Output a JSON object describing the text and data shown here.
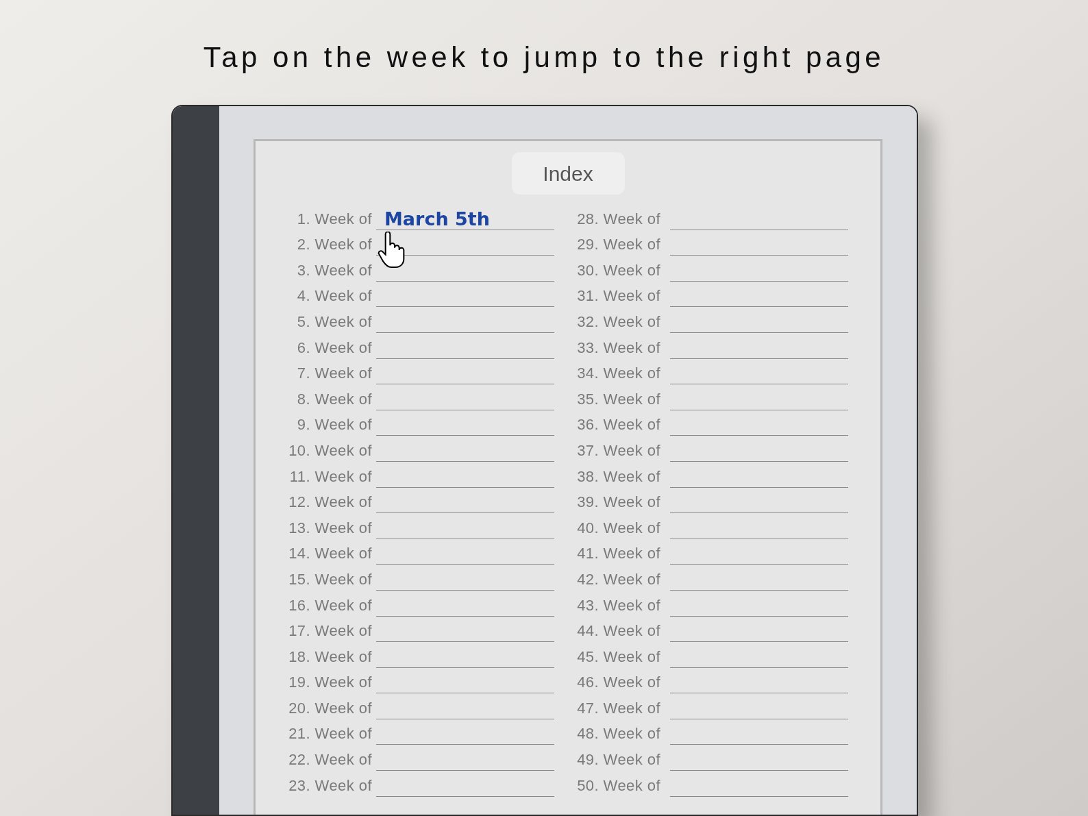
{
  "headline": "Tap on the week to jump to the right page",
  "index": {
    "title": "Index",
    "columns": [
      {
        "entries": [
          {
            "number": "1.",
            "label": "Week of",
            "value": "March 5th"
          },
          {
            "number": "2.",
            "label": "Week of"
          },
          {
            "number": "3.",
            "label": "Week of"
          },
          {
            "number": "4.",
            "label": "Week of"
          },
          {
            "number": "5.",
            "label": "Week of"
          },
          {
            "number": "6.",
            "label": "Week of"
          },
          {
            "number": "7.",
            "label": "Week of"
          },
          {
            "number": "8.",
            "label": "Week of"
          },
          {
            "number": "9.",
            "label": "Week of"
          },
          {
            "number": "10.",
            "label": "Week of"
          },
          {
            "number": "11.",
            "label": "Week of"
          },
          {
            "number": "12.",
            "label": "Week of"
          },
          {
            "number": "13.",
            "label": "Week of"
          },
          {
            "number": "14.",
            "label": "Week of"
          },
          {
            "number": "15.",
            "label": "Week of"
          },
          {
            "number": "16.",
            "label": "Week of"
          },
          {
            "number": "17.",
            "label": "Week of"
          },
          {
            "number": "18.",
            "label": "Week of"
          },
          {
            "number": "19.",
            "label": "Week of"
          },
          {
            "number": "20.",
            "label": "Week of"
          },
          {
            "number": "21.",
            "label": "Week of"
          },
          {
            "number": "22.",
            "label": "Week of"
          },
          {
            "number": "23.",
            "label": "Week of"
          }
        ]
      },
      {
        "entries": [
          {
            "number": "28.",
            "label": "Week of"
          },
          {
            "number": "29.",
            "label": "Week of"
          },
          {
            "number": "30.",
            "label": "Week of"
          },
          {
            "number": "31.",
            "label": "Week of"
          },
          {
            "number": "32.",
            "label": "Week of"
          },
          {
            "number": "33.",
            "label": "Week of"
          },
          {
            "number": "34.",
            "label": "Week of"
          },
          {
            "number": "35.",
            "label": "Week of"
          },
          {
            "number": "36.",
            "label": "Week of"
          },
          {
            "number": "37.",
            "label": "Week of"
          },
          {
            "number": "38.",
            "label": "Week of"
          },
          {
            "number": "39.",
            "label": "Week of"
          },
          {
            "number": "40.",
            "label": "Week of"
          },
          {
            "number": "41.",
            "label": "Week of"
          },
          {
            "number": "42.",
            "label": "Week of"
          },
          {
            "number": "43.",
            "label": "Week of"
          },
          {
            "number": "44.",
            "label": "Week of"
          },
          {
            "number": "45.",
            "label": "Week of"
          },
          {
            "number": "46.",
            "label": "Week of"
          },
          {
            "number": "47.",
            "label": "Week of"
          },
          {
            "number": "48.",
            "label": "Week of"
          },
          {
            "number": "49.",
            "label": "Week of"
          },
          {
            "number": "50.",
            "label": "Week of"
          }
        ]
      }
    ]
  }
}
